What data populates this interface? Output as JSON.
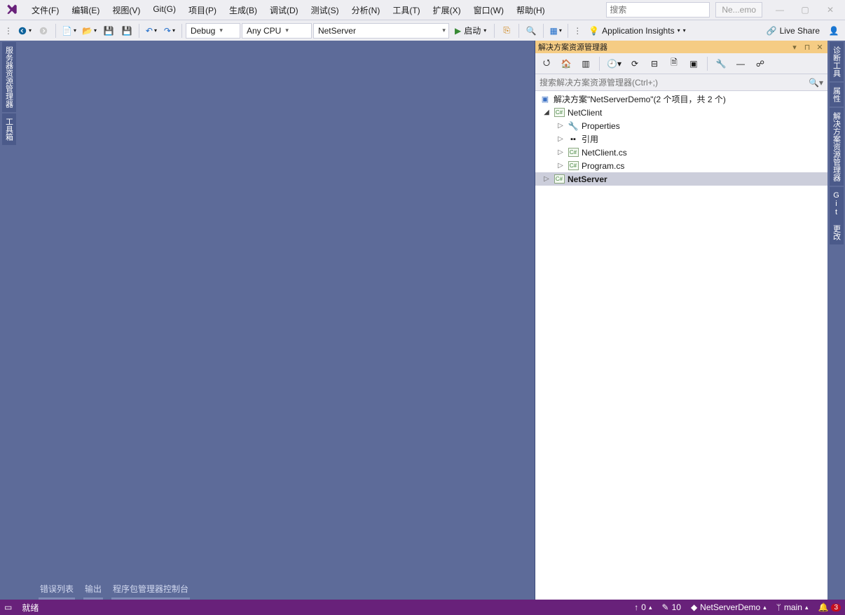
{
  "menu": {
    "items": [
      "文件(F)",
      "编辑(E)",
      "视图(V)",
      "Git(G)",
      "项目(P)",
      "生成(B)",
      "调试(D)",
      "测试(S)",
      "分析(N)",
      "工具(T)",
      "扩展(X)",
      "窗口(W)",
      "帮助(H)"
    ]
  },
  "title": {
    "search_placeholder": "搜索",
    "doc_name": "Ne...emo"
  },
  "toolbar": {
    "config": "Debug",
    "platform": "Any CPU",
    "startup_project": "NetServer",
    "start_label": "启动",
    "insights_label": "Application Insights",
    "live_share_label": "Live Share"
  },
  "left_tabs": [
    "服务器资源管理器",
    "工具箱"
  ],
  "right_tabs": [
    "诊断工具",
    "属性",
    "解决方案资源管理器",
    "Git 更改"
  ],
  "bottom_tabs": [
    "错误列表",
    "输出",
    "程序包管理器控制台"
  ],
  "sxp": {
    "title": "解决方案资源管理器",
    "search_placeholder": "搜索解决方案资源管理器(Ctrl+;)",
    "solution_label": "解决方案\"NetServerDemo\"(2 个项目，共 2 个)",
    "tree": {
      "proj1": {
        "name": "NetClient",
        "props": "Properties",
        "refs": "引用",
        "f1": "NetClient.cs",
        "f2": "Program.cs"
      },
      "proj2": {
        "name": "NetServer"
      }
    }
  },
  "status": {
    "ready": "就绪",
    "up_count": "0",
    "edit_count": "10",
    "repo": "NetServerDemo",
    "branch": "main",
    "notif": "3"
  }
}
